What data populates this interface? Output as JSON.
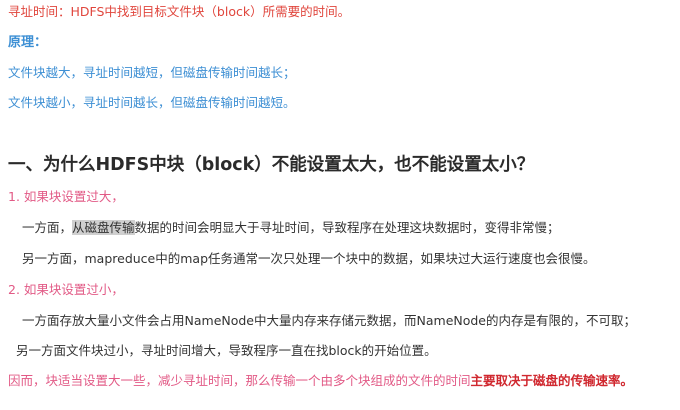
{
  "paragraphs": {
    "intro_seek_time": "寻址时间：HDFS中找到目标文件块（block）所需要的时间。",
    "principle_label": "原理：",
    "principle_1": "文件块越大，寻址时间越短，但磁盘传输时间越长；",
    "principle_2": "文件块越小，寻址时间越长，但磁盘传输时间越短。"
  },
  "section": {
    "heading": "一、为什么HDFS中块（block）不能设置太大，也不能设置太小？",
    "point_1_label": "1. 如果块设置过大，",
    "point_1_line_a_pre": "一方面，",
    "point_1_line_a_highlight": "从磁盘传输",
    "point_1_line_a_post": "数据的时间会明显大于寻址时间，导致程序在处理这块数据时，变得非常慢；",
    "point_1_line_b": "另一方面，mapreduce中的map任务通常一次只处理一个块中的数据，如果块过大运行速度也会很慢。",
    "point_2_label": "2. 如果块设置过小，",
    "point_2_line_a": "一方面存放大量小文件会占用NameNode中大量内存来存储元数据，而NameNode的内存是有限的，不可取；",
    "point_2_line_b": "另一方面文件块过小，寻址时间增大，导致程序一直在找block的开始位置。",
    "conclusion_pre": "因而，块适当设置大一些，减少寻址时间，那么传输一个由多个块组成的文件的时间",
    "conclusion_emphasis": "主要取决于磁盘的传输速率。"
  }
}
